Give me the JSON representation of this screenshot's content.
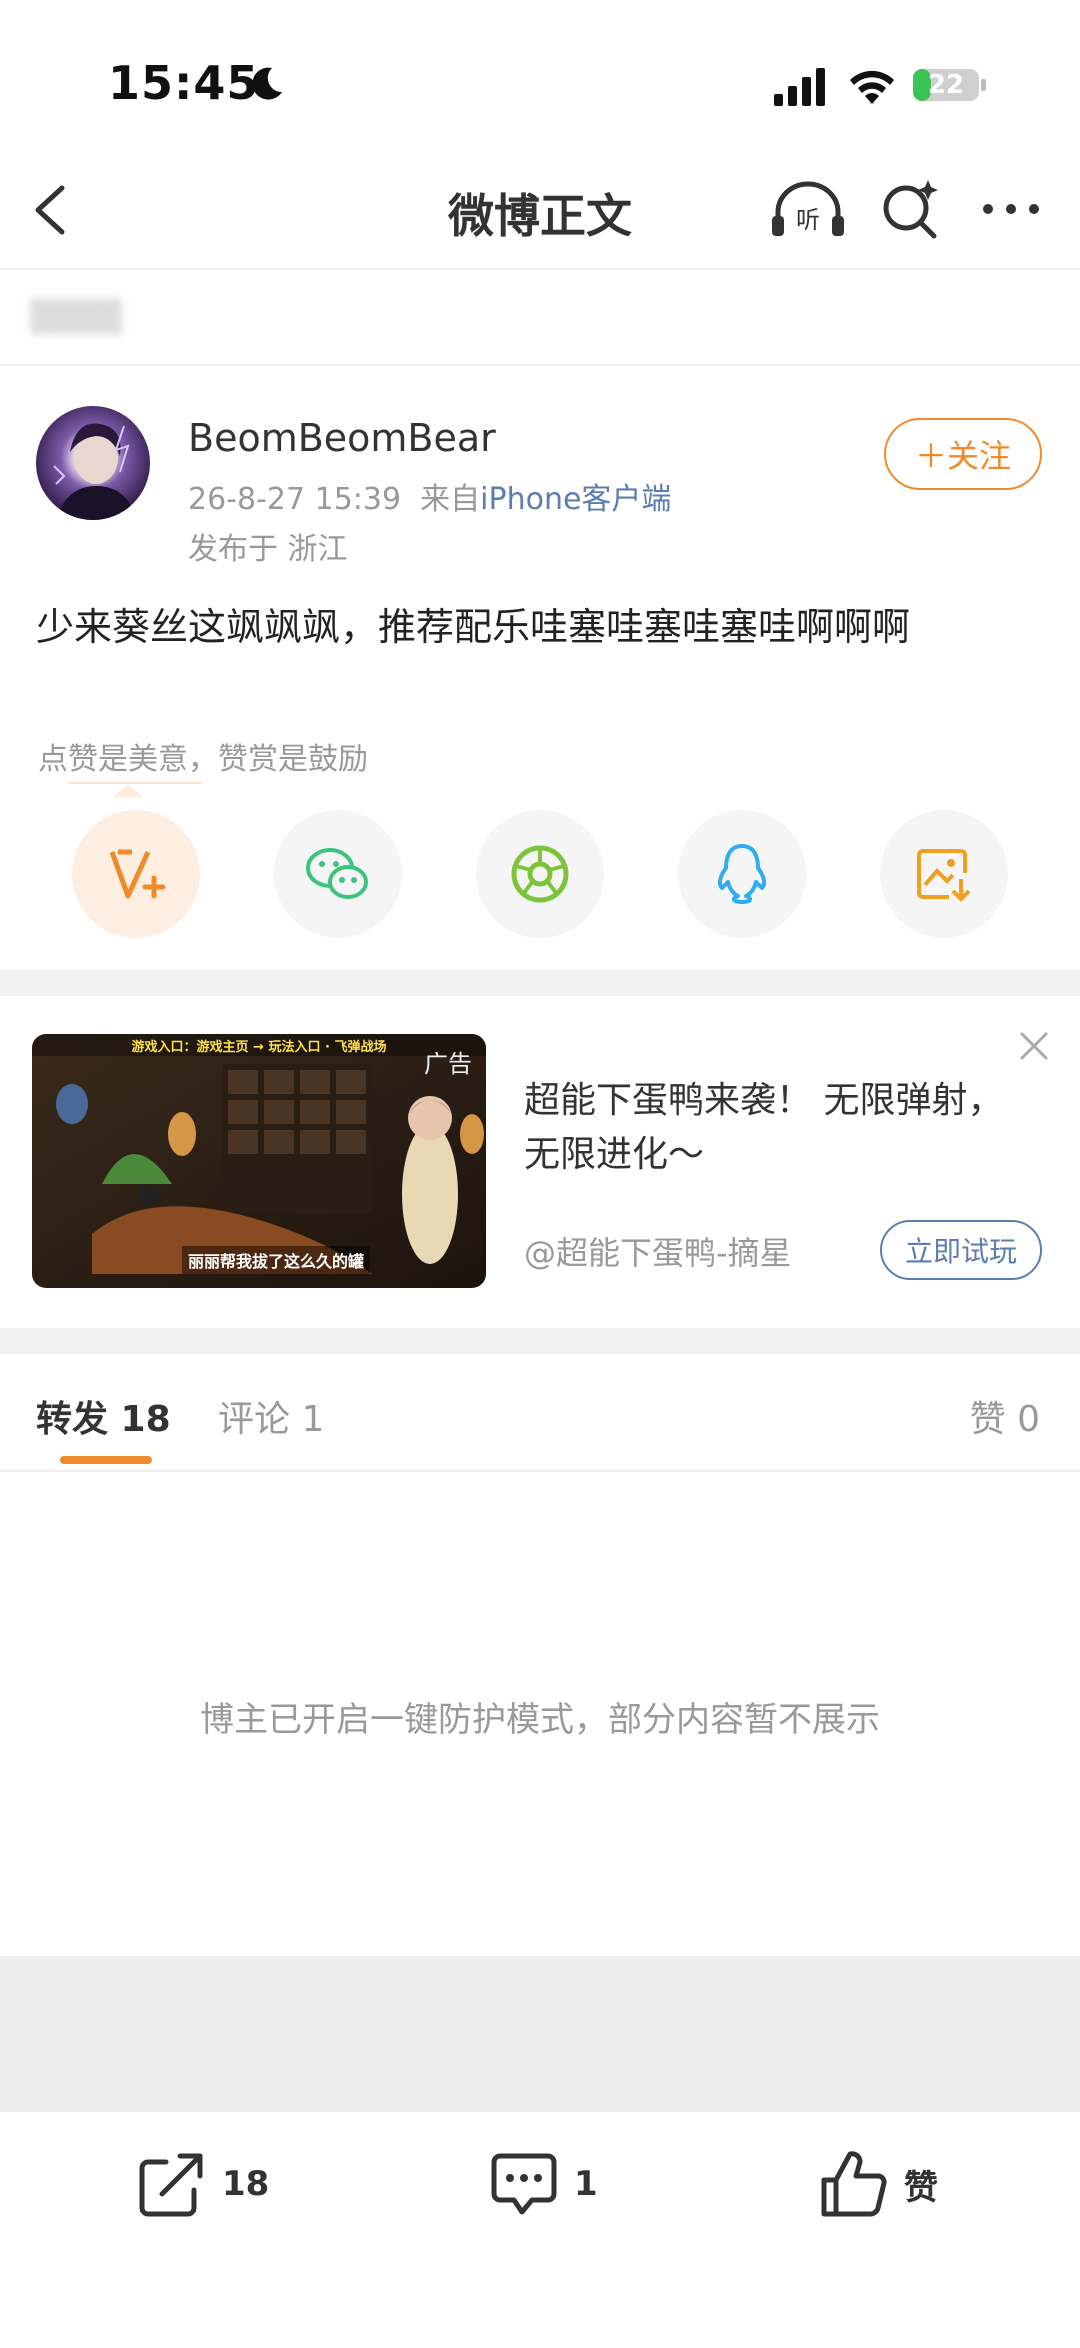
{
  "status_bar": {
    "time": "15:45",
    "battery": "22"
  },
  "nav": {
    "title": "微博正文"
  },
  "post": {
    "username": "BeomBeomBear",
    "datetime": "26-8-27 15:39",
    "from_prefix": "来自",
    "source": "iPhone客户端",
    "location": "发布于 浙江",
    "follow_label": "＋关注",
    "text": "少来葵丝这飒飒飒，推荐配乐哇塞哇塞哇塞哇啊啊啊",
    "reward_hint": "点赞是美意，赞赏是鼓励"
  },
  "ad": {
    "label": "广告",
    "title": "超能下蛋鸭来袭！ 无限弹射，无限进化～",
    "account": "@超能下蛋鸭-摘星",
    "cta": "立即试玩",
    "image_top_text": "游戏入口：游戏主页 → 玩法入口 · 飞弹战场",
    "image_caption": "丽丽帮我拔了这么久的罐"
  },
  "tabs": {
    "repost": "转发 18",
    "comment": "评论 1",
    "like": "赞 0"
  },
  "empty_message": "博主已开启一键防护模式，部分内容暂不展示",
  "bottom_bar": {
    "repost_count": "18",
    "comment_count": "1",
    "like_label": "赞"
  },
  "colors": {
    "accent": "#f08b2c",
    "link": "#5b7db0"
  }
}
